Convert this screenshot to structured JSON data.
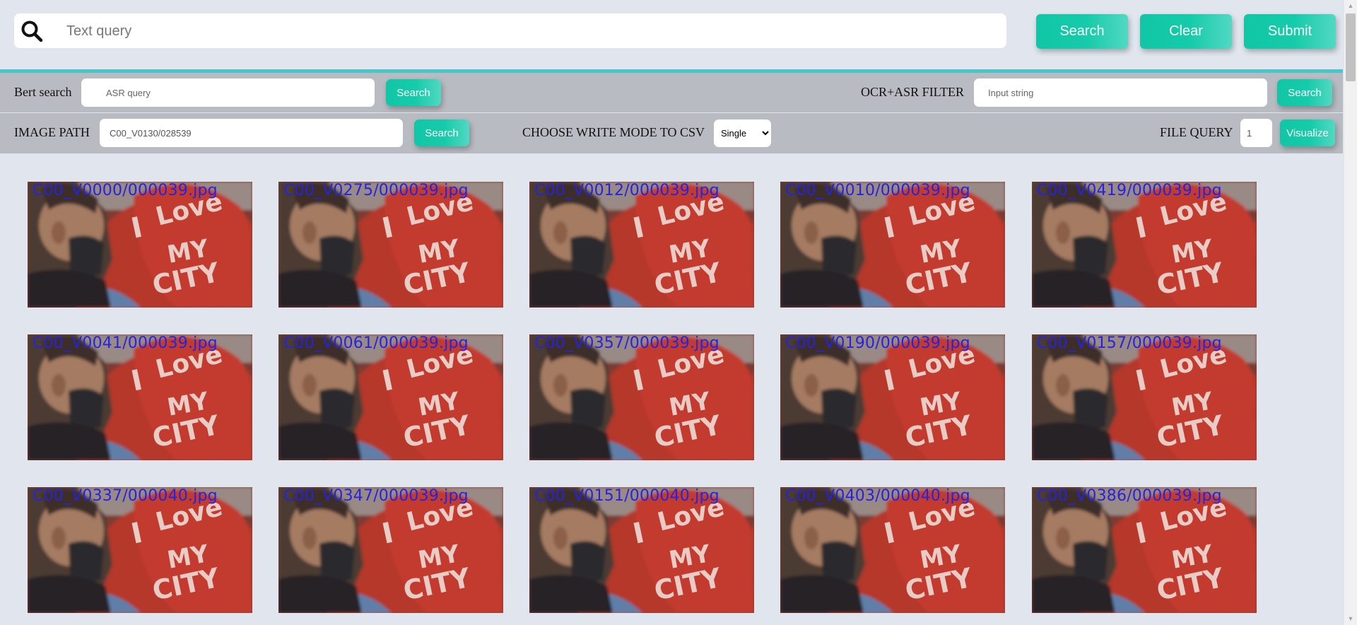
{
  "top": {
    "query_placeholder": "Text query",
    "search_label": "Search",
    "clear_label": "Clear",
    "submit_label": "Submit"
  },
  "row1": {
    "bert_label": "Bert search",
    "asr_placeholder": "ASR query",
    "bert_search_label": "Search",
    "filter_label": "OCR+ASR FILTER",
    "filter_placeholder": "Input string",
    "filter_search_label": "Search"
  },
  "row2": {
    "image_path_label": "IMAGE PATH",
    "image_path_value": "C00_V0130/028539",
    "image_search_label": "Search",
    "write_mode_label": "CHOOSE WRITE MODE TO CSV",
    "write_mode_selected": "Single",
    "file_query_label": "FILE QUERY",
    "file_query_value": "1",
    "visualize_label": "Visualize"
  },
  "results": [
    "C00_V0000/000039.jpg",
    "C00_V0275/000039.jpg",
    "C00_V0012/000039.jpg",
    "C00_V0010/000039.jpg",
    "C00_V0419/000039.jpg",
    "C00_V0041/000039.jpg",
    "C00_V0061/000039.jpg",
    "C00_V0357/000039.jpg",
    "C00_V0190/000039.jpg",
    "C00_V0157/000039.jpg",
    "C00_V0337/000040.jpg",
    "C00_V0347/000039.jpg",
    "C00_V0151/000040.jpg",
    "C00_V0403/000040.jpg",
    "C00_V0386/000039.jpg"
  ],
  "thumbnail_art": {
    "heart_text": [
      "I",
      "Love",
      "MY",
      "CITY"
    ]
  },
  "colors": {
    "accent": "#14c9a7",
    "divider": "#4bc6c8",
    "caption": "#2424e0",
    "panel": "#b8bcc2",
    "background": "#e1e6ee"
  }
}
